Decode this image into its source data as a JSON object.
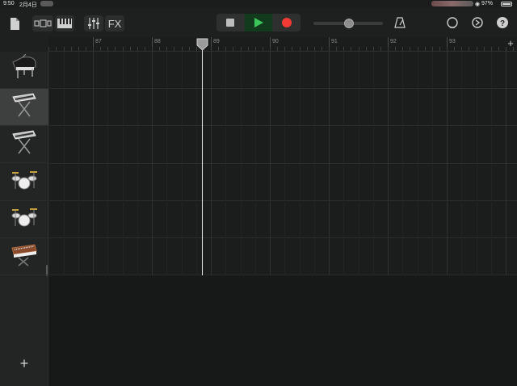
{
  "status_bar": {
    "time": "9:50",
    "date": "2月4日",
    "battery": "97%"
  },
  "toolbar": {
    "fx_label": "FX",
    "colors": {
      "play": "#3cc55a",
      "record": "#f23b35",
      "stop": "#bdbdbd"
    }
  },
  "tempo_slider": {
    "level": 0.5
  },
  "ruler": {
    "bars": [
      "87",
      "88",
      "89",
      "90",
      "91",
      "92",
      "93"
    ]
  },
  "tracks": [
    {
      "instrument": "grand-piano",
      "selected": false
    },
    {
      "instrument": "keyboard-stand",
      "selected": true
    },
    {
      "instrument": "keyboard-stand",
      "selected": false
    },
    {
      "instrument": "drum-kit",
      "selected": false
    },
    {
      "instrument": "drum-kit",
      "selected": false
    },
    {
      "instrument": "analog-synth",
      "selected": false
    }
  ],
  "playhead": {
    "bar": 88.85
  }
}
